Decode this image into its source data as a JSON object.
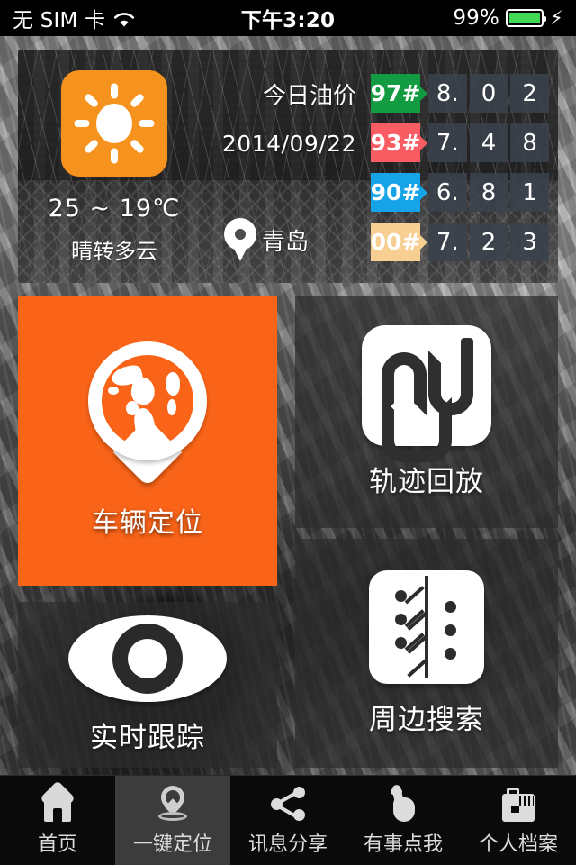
{
  "status_bar": {
    "carrier": "无 SIM 卡",
    "wifi_icon": "wifi-icon",
    "time": "下午3:20",
    "battery_percent": "99%",
    "battery_icon": "battery-icon",
    "charging_icon": "lightning-bolt-icon",
    "battery_color": "#43d854"
  },
  "weather": {
    "icon": "sun-icon",
    "icon_bg_color": "#F6921E",
    "temperature": "25 ~ 19℃",
    "condition": "晴转多云"
  },
  "fuel_panel": {
    "title": "今日油价",
    "date": "2014/09/22",
    "location_icon": "map-pin-icon",
    "city": "青岛",
    "rows": [
      {
        "grade": "97#",
        "color": "#129b41",
        "digits": [
          "8.",
          "0",
          "2"
        ]
      },
      {
        "grade": "93#",
        "color": "#f95d63",
        "digits": [
          "7.",
          "4",
          "8"
        ]
      },
      {
        "grade": "90#",
        "color": "#15a4e8",
        "digits": [
          "6.",
          "8",
          "1"
        ]
      },
      {
        "grade": "00#",
        "color": "#f8cf93",
        "digits": [
          "7.",
          "2",
          "3"
        ]
      }
    ]
  },
  "tiles": [
    {
      "id": "locate",
      "label": "车辆定位",
      "icon": "globe-pin-icon",
      "bg_color": "#FA6418"
    },
    {
      "id": "track",
      "label": "轨迹回放",
      "icon": "su-logo-icon",
      "bg_color": "rgba(45,45,45,.72)"
    },
    {
      "id": "live",
      "label": "实时跟踪",
      "icon": "eye-icon",
      "bg_color": "rgba(45,45,45,.72)"
    },
    {
      "id": "nearby",
      "label": "周边搜索",
      "icon": "branch-icon",
      "bg_color": "rgba(45,45,45,.72)"
    }
  ],
  "tabbar": {
    "items": [
      {
        "label": "首页",
        "icon": "house-icon",
        "active": false
      },
      {
        "label": "一键定位",
        "icon": "globe-pin-icon",
        "active": true
      },
      {
        "label": "讯息分享",
        "icon": "share-icon",
        "active": false
      },
      {
        "label": "有事点我",
        "icon": "hand-pointer-icon",
        "active": false
      },
      {
        "label": "个人档案",
        "icon": "briefcase-icon",
        "active": false
      }
    ]
  }
}
